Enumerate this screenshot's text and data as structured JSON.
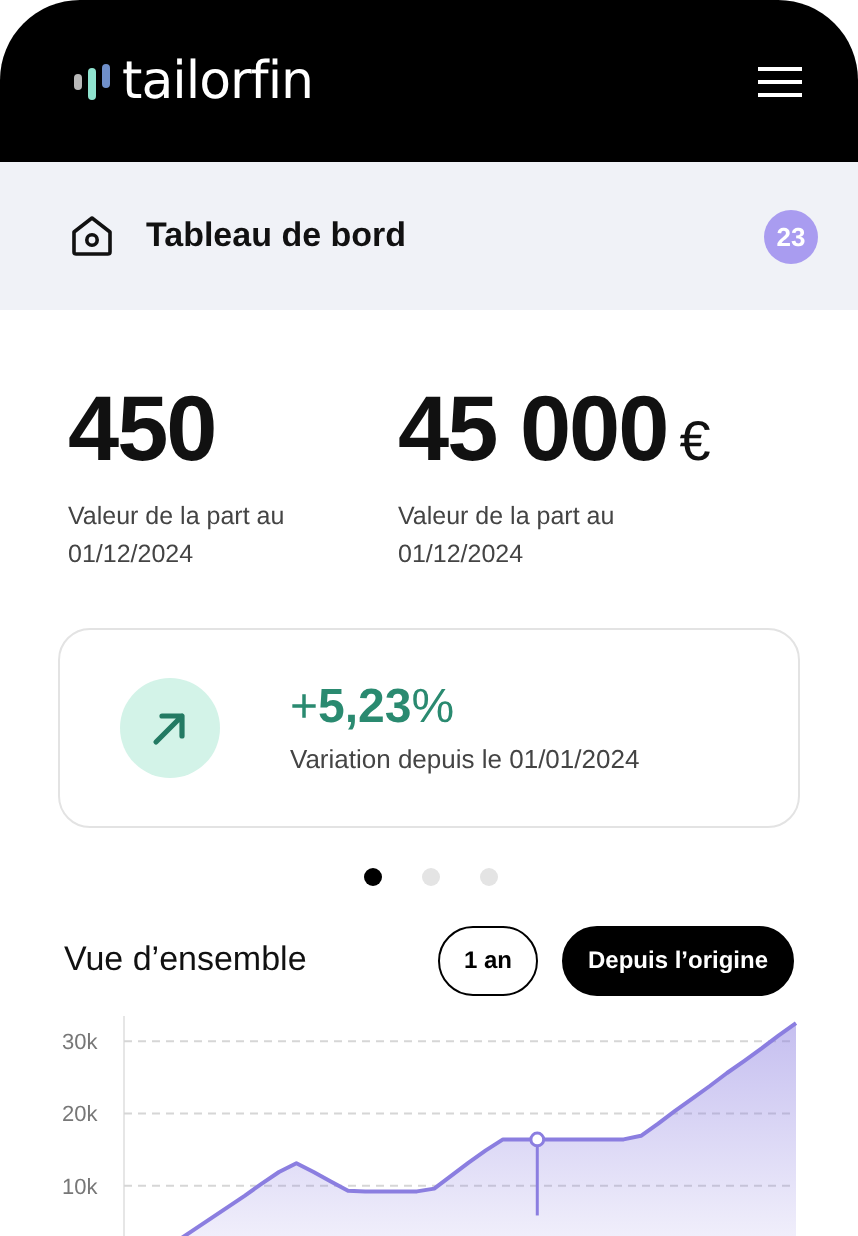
{
  "header": {
    "logo": "tailorfin"
  },
  "breadcrumb": {
    "title": "Tableau de bord",
    "badge": "23"
  },
  "stats": [
    {
      "value": "450",
      "label": "Valeur de la part au 01/12/2024"
    },
    {
      "value": "45 000",
      "unit": "€",
      "label": "Valeur de la part au 01/12/2024"
    }
  ],
  "variation": {
    "sign": "+",
    "value": "5,23",
    "percent": "%",
    "label": "Variation depuis le 01/01/2024"
  },
  "pager": [
    {
      "selected": true
    },
    {
      "selected": false
    },
    {
      "selected": false
    }
  ],
  "overview": {
    "title": "Vue d’ensemble",
    "ranges": [
      {
        "label": "1 an",
        "selected": false
      },
      {
        "label": "Depuis l’origine",
        "selected": true
      }
    ],
    "chart_data": {
      "type": "area",
      "categories": [
        null,
        null,
        null,
        null,
        null,
        null,
        null,
        null,
        null,
        null,
        null,
        null,
        null,
        null,
        null,
        null,
        null,
        null,
        null,
        null,
        null,
        null,
        null,
        null,
        null,
        null,
        null,
        null,
        null,
        null,
        null,
        null,
        null,
        null,
        null,
        null,
        null,
        null,
        null,
        null
      ],
      "ylim": [
        2.2,
        33.5
      ],
      "grid": true,
      "yticks": [
        {
          "value": 10,
          "label": "10k"
        },
        {
          "value": 20,
          "label": "20k"
        },
        {
          "value": 30,
          "label": "30k"
        }
      ],
      "series": [
        {
          "color": "#8b7ee0",
          "values": [
            null,
            null,
            null,
            2.2,
            3.8,
            5.4,
            7,
            8.6,
            10.3,
            11.9,
            13.1,
            11.9,
            10.6,
            9.3,
            9.2,
            9.2,
            9.2,
            9.2,
            9.6,
            11.4,
            13.2,
            14.9,
            16.4,
            16.4,
            16.4,
            16.4,
            16.4,
            16.4,
            16.4,
            16.4,
            16.9,
            18.6,
            20.4,
            22.1,
            23.8,
            25.6,
            27.3,
            29,
            30.8,
            32.5
          ]
        }
      ]
    },
    "cursor": {
      "level": 0.615
    }
  }
}
